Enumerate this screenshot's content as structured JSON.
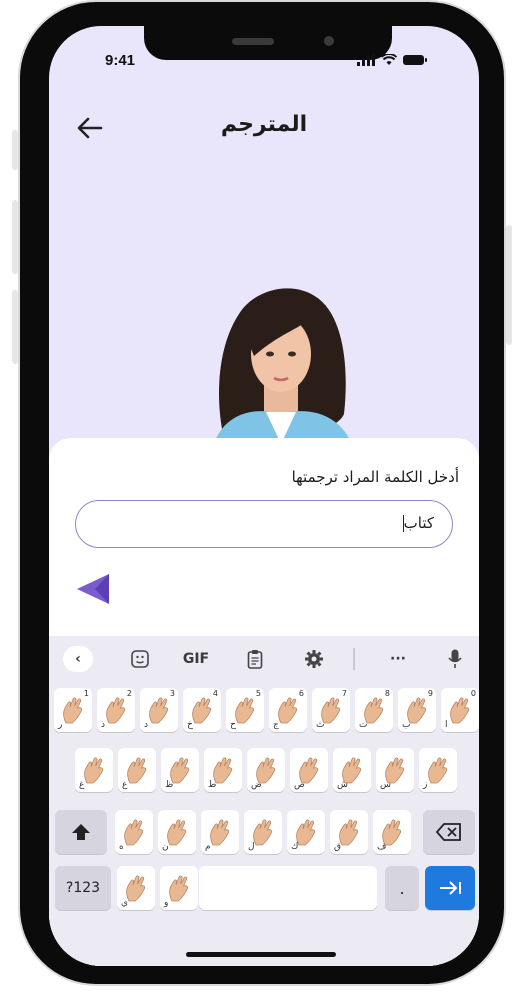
{
  "status": {
    "time": "9:41"
  },
  "header": {
    "title": "المترجم",
    "back_icon": "arrow-left-icon"
  },
  "avatar": {
    "alt": "avatar"
  },
  "sheet": {
    "prompt": "أدخل الكلمة المراد ترجمتها",
    "input_value": "كتاب",
    "send_icon": "send-triangle-icon"
  },
  "keyboard": {
    "toolbar": {
      "gif": "GIF",
      "more": "···"
    },
    "row1": [
      {
        "num": "1",
        "letter": "ر"
      },
      {
        "num": "2",
        "letter": "ذ"
      },
      {
        "num": "3",
        "letter": "د"
      },
      {
        "num": "4",
        "letter": "خ"
      },
      {
        "num": "5",
        "letter": "ح"
      },
      {
        "num": "6",
        "letter": "ج"
      },
      {
        "num": "7",
        "letter": "ث"
      },
      {
        "num": "8",
        "letter": "ت"
      },
      {
        "num": "9",
        "letter": "ب"
      },
      {
        "num": "0",
        "letter": "ا"
      }
    ],
    "row2": [
      {
        "letter": "غ"
      },
      {
        "letter": "ع"
      },
      {
        "letter": "ظ"
      },
      {
        "letter": "ط"
      },
      {
        "letter": "ض"
      },
      {
        "letter": "ص"
      },
      {
        "letter": "ش"
      },
      {
        "letter": "س"
      },
      {
        "letter": "ز"
      }
    ],
    "row3": [
      {
        "letter": "ه"
      },
      {
        "letter": "ن"
      },
      {
        "letter": "م"
      },
      {
        "letter": "ل"
      },
      {
        "letter": "ك"
      },
      {
        "letter": "ق"
      },
      {
        "letter": "ف"
      }
    ],
    "row4": [
      {
        "letter": "ي"
      },
      {
        "letter": "و"
      }
    ],
    "symbols_label": "?123",
    "period_label": "."
  },
  "colors": {
    "accent": "#7a5ccf",
    "enter": "#1f7ae0",
    "screen_bg": "#e9e5fa"
  }
}
